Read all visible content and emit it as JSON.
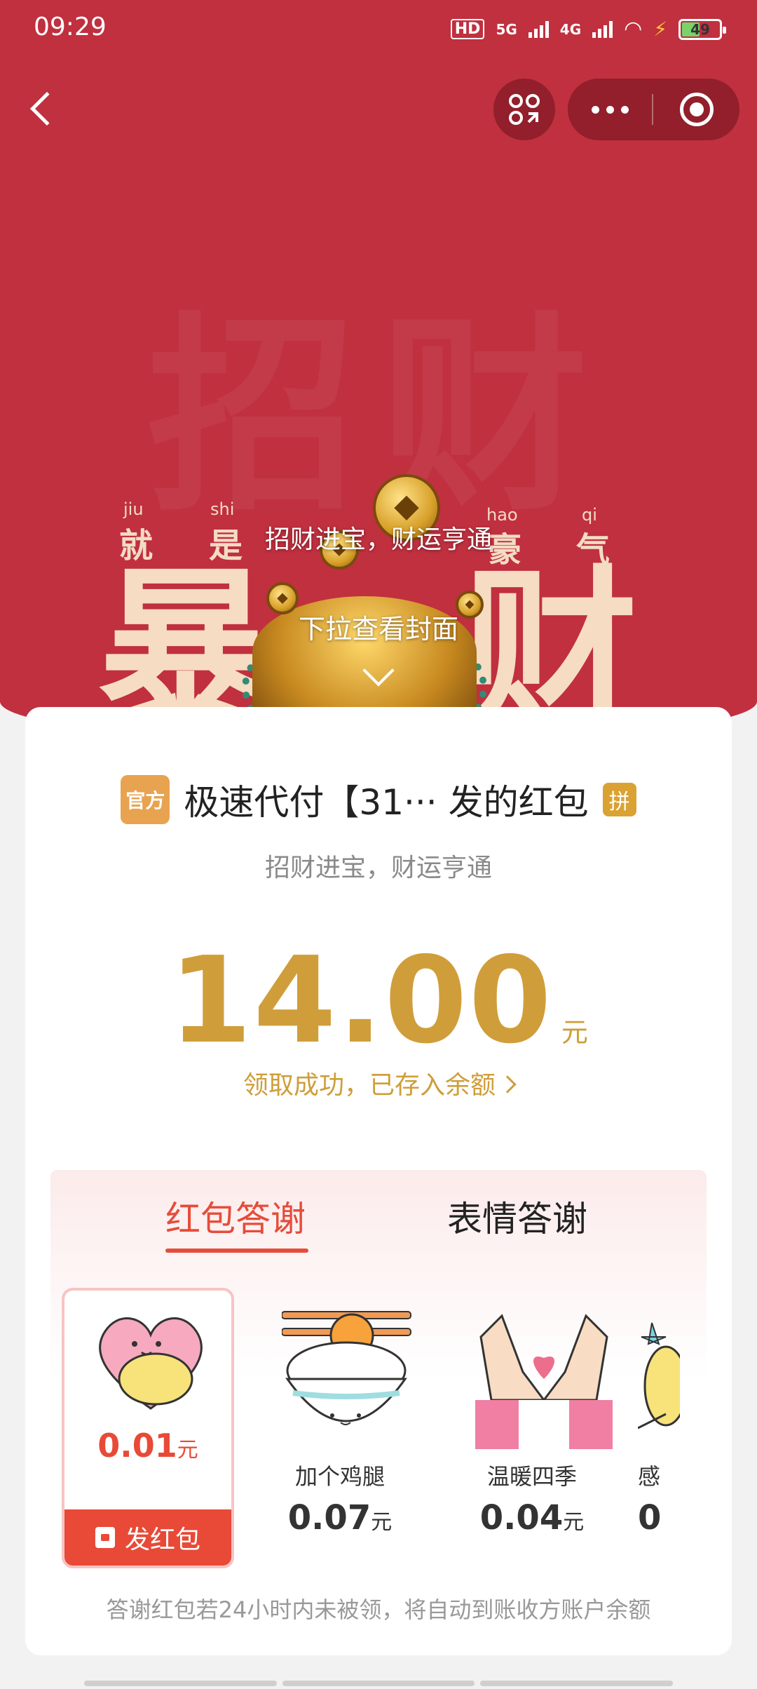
{
  "status_bar": {
    "time": "09:29",
    "hd_label": "HD",
    "net1": "5G",
    "net2": "4G",
    "battery": "49",
    "battery_level": 0.49
  },
  "cover": {
    "caption": "招财进宝，财运亨通",
    "pull_hint": "下拉查看封面",
    "pinyin": [
      "jiu",
      "shi",
      "hao",
      "qi"
    ],
    "small_chars": [
      "就",
      "是",
      "豪",
      "气"
    ],
    "big_chars": [
      "暴",
      "财"
    ],
    "bg_color": "#c0303f"
  },
  "card": {
    "badge": "官方",
    "sender": "极速代付【31··· 发的红包",
    "pin_badge": "拼",
    "wish": "招财进宝，财运亨通",
    "amount": "14.00",
    "unit": "元",
    "status": "领取成功，已存入余额",
    "accent_color": "#cf9e3a"
  },
  "thanks": {
    "tabs": [
      {
        "label": "红包答谢",
        "active": true
      },
      {
        "label": "表情答谢",
        "active": false
      }
    ],
    "items": [
      {
        "name": "",
        "price": "0.01",
        "unit": "元",
        "selected": true,
        "button": "发红包"
      },
      {
        "name": "加个鸡腿",
        "price": "0.07",
        "unit": "元",
        "selected": false
      },
      {
        "name": "温暖四季",
        "price": "0.04",
        "unit": "元",
        "selected": false
      },
      {
        "name": "感",
        "price": "0",
        "unit": "",
        "selected": false
      }
    ],
    "footnote": "答谢红包若24小时内未被领，将自动到账收方账户余额"
  }
}
